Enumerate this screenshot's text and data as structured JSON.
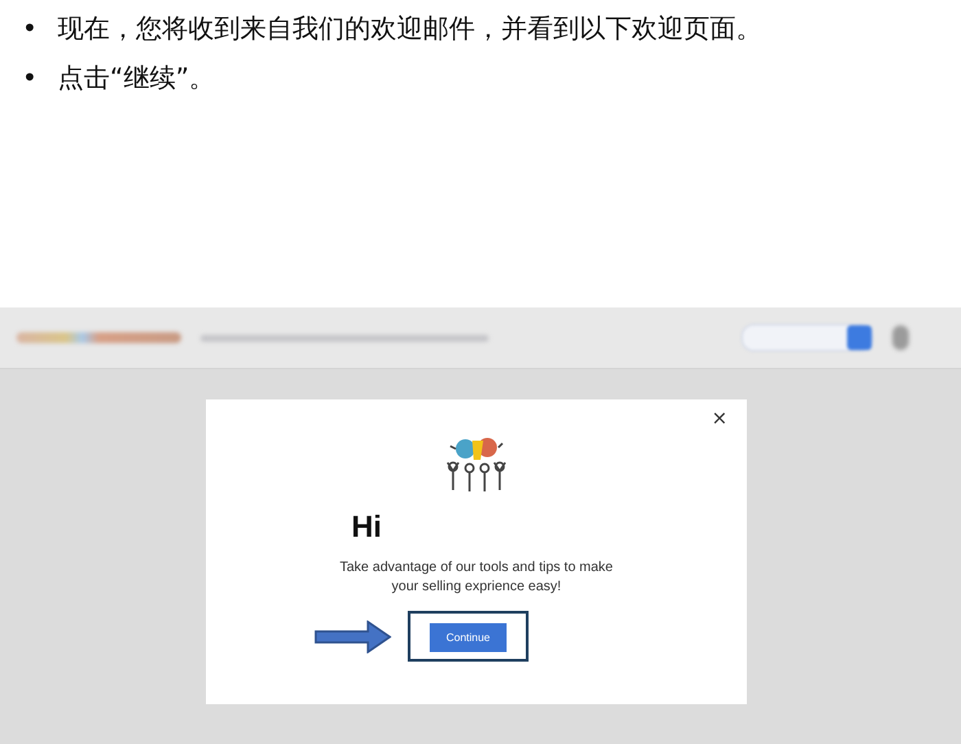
{
  "bullets": [
    {
      "marker": "•",
      "text": "现在，您将收到来自我们的欢迎邮件，并看到以下欢迎页面。"
    },
    {
      "marker": "•",
      "text": "点击“继续”。"
    }
  ],
  "screenshot": {
    "dialog": {
      "close": "×",
      "title": "Hi",
      "message": "Take advantage of our tools and tips to make your selling exprience easy!",
      "button": "Continue"
    }
  }
}
